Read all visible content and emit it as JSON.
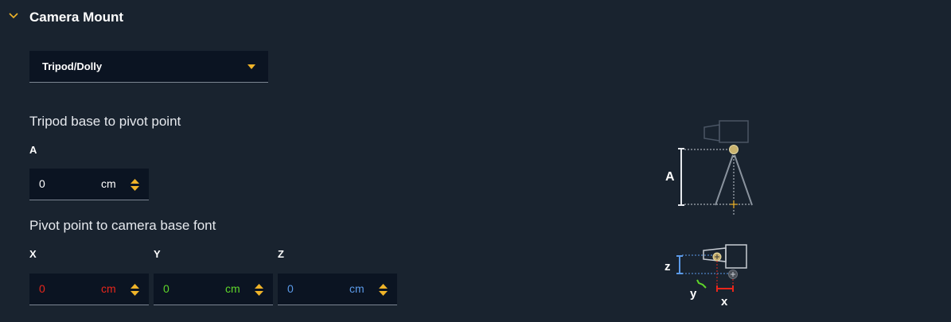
{
  "section": {
    "title": "Camera Mount",
    "expanded": true
  },
  "mount_type": {
    "selected": "Tripod/Dolly"
  },
  "tripod": {
    "group_label": "Tripod base to pivot point",
    "a": {
      "label": "A",
      "value": "0",
      "unit": "cm"
    }
  },
  "pivot": {
    "group_label": "Pivot point to camera base font",
    "x": {
      "label": "X",
      "value": "0",
      "unit": "cm"
    },
    "y": {
      "label": "Y",
      "value": "0",
      "unit": "cm"
    },
    "z": {
      "label": "Z",
      "value": "0",
      "unit": "cm"
    }
  },
  "diagram": {
    "top_axis_label": "A",
    "bottom_labels": {
      "z": "z",
      "y": "y",
      "x": "x"
    }
  },
  "colors": {
    "background": "#19232f",
    "field_bg": "#0b1422",
    "accent": "#f0b429",
    "x_axis": "#e8261b",
    "y_axis": "#5fd62a",
    "z_axis": "#5b9ae8"
  }
}
